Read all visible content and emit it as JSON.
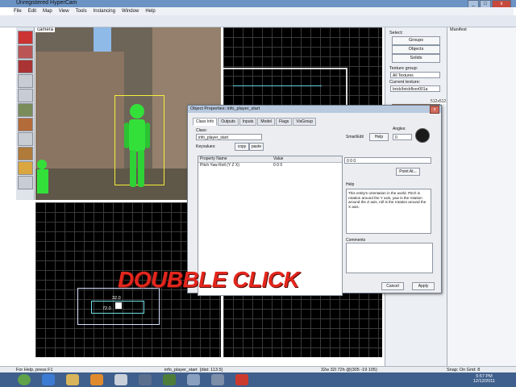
{
  "window": {
    "title": "Unregistered HyperCam",
    "controls": [
      "_",
      "□",
      "x"
    ]
  },
  "menu": [
    "File",
    "Edit",
    "Map",
    "View",
    "Tools",
    "Instancing",
    "Window",
    "Help"
  ],
  "viewport_3d": {
    "label": "camera"
  },
  "right_panel": {
    "select_label": "Select:",
    "buttons": [
      "Groups",
      "Objects",
      "Solids"
    ],
    "texture_group_label": "Texture group:",
    "texture_group_value": "All Textures",
    "current_texture_label": "Current texture:",
    "current_texture_value": "brick/brickfloor001a",
    "texture_size": "512x512",
    "far_right_label": "Manifest"
  },
  "dialog": {
    "title": "Object Properties: info_player_start",
    "tabs": [
      "Class Info",
      "Outputs",
      "Inputs",
      "Model",
      "Flags",
      "VisGroup"
    ],
    "class_label": "Class:",
    "class_value": "info_player_start",
    "keyvalues_label": "Keyvalues:",
    "copy_label": "copy",
    "paste_label": "paste",
    "smartedit_label": "SmartEdit",
    "help_button": "Help",
    "angles_label": "Angles:",
    "angles_value": "0",
    "col_property": "Property Name",
    "col_value": "Value",
    "rows": [
      {
        "name": "Pitch Yaw Roll (Y Z X)",
        "value": "0 0 0"
      }
    ],
    "value_field": "0 0 0",
    "point_at_button": "Point At...",
    "help_label": "Help",
    "help_text": "This entity's orientation in the world. Pitch is rotation around the Y axis, yaw is the rotation around the Z axis, roll is the rotation around the X axis.",
    "comments_label": "Comments",
    "cancel_button": "Cancel",
    "apply_button": "Apply"
  },
  "overlay_text": "DOUBBLE CLICK",
  "brush_dims": {
    "width": "32.0",
    "height": "72.0"
  },
  "status": {
    "left": "For Help, press F1",
    "entity": "info_player_start",
    "dist": "[dist: 113.5]",
    "coords": "32w 32l 72h @(305 -19 105)",
    "snap": "Snap: On Grid: 8"
  },
  "clock": {
    "time": "5:57 PM",
    "date": "12/12/2011"
  },
  "colors": {
    "overlay": "#e3261d",
    "player": "#33e03a",
    "bbox": "#f5ef3a",
    "grid_bg": "#000000"
  }
}
